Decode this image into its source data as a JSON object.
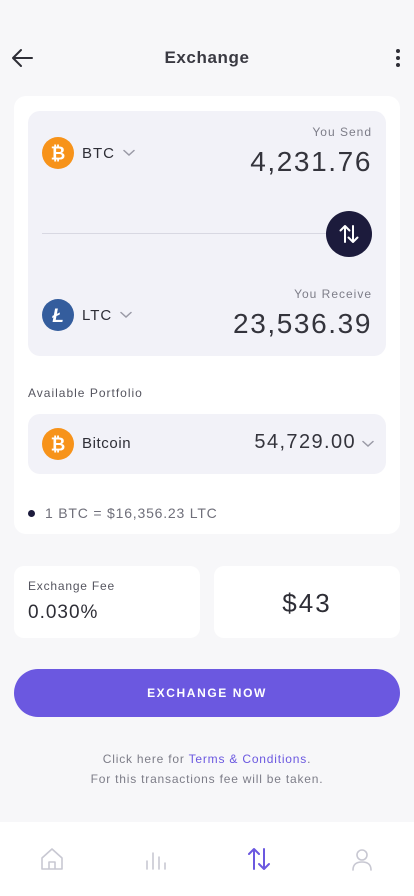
{
  "header": {
    "title": "Exchange",
    "back_icon": "arrow-left-icon",
    "menu_icon": "more-vertical-icon"
  },
  "send": {
    "coin_code": "BTC",
    "coin_icon": "bitcoin-icon",
    "caption": "You Send",
    "amount": "4,231.76"
  },
  "receive": {
    "coin_code": "LTC",
    "coin_icon": "litecoin-icon",
    "caption": "You Receive",
    "amount": "23,536.39"
  },
  "swap_icon": "swap-arrows-icon",
  "portfolio": {
    "label": "Available Portfolio",
    "coin_name": "Bitcoin",
    "coin_icon": "bitcoin-icon",
    "value": "54,729.00"
  },
  "rate": {
    "text": "1 BTC = $16,356.23 LTC"
  },
  "fee": {
    "label": "Exchange Fee",
    "value": "0.030%"
  },
  "total": {
    "value": "$43"
  },
  "cta": {
    "label": "EXCHANGE NOW"
  },
  "terms": {
    "prefix": "Click here for ",
    "link": "Terms & Conditions",
    "suffix": ".",
    "line2": "For this transactions fee will be taken."
  },
  "bottom_nav": [
    {
      "icon": "home-icon",
      "active": false
    },
    {
      "icon": "bar-chart-icon",
      "active": false
    },
    {
      "icon": "swap-arrows-icon",
      "active": true
    },
    {
      "icon": "user-icon",
      "active": false
    }
  ],
  "colors": {
    "accent": "#6b58e0",
    "dark": "#1c1b3c",
    "bitcoin": "#f7931a",
    "litecoin": "#345d9d",
    "background": "#f7f7f9",
    "panel": "#f2f2f8"
  }
}
